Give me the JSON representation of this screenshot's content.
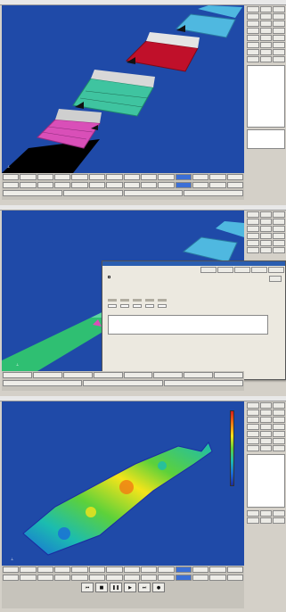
{
  "panel1": {
    "toolbar_rows": [
      [
        "",
        "",
        "",
        "",
        "",
        "",
        "",
        "",
        "",
        "",
        "",
        "",
        "",
        "",
        "",
        "",
        "",
        "",
        "",
        ""
      ],
      [
        "",
        "",
        "",
        "",
        "",
        "",
        "",
        "",
        "",
        "",
        "",
        "",
        "",
        "",
        "",
        "",
        "",
        "",
        "",
        ""
      ]
    ]
  },
  "panel2": {
    "dialog": {
      "title": "",
      "red_text": "",
      "checkbox_label": ""
    }
  },
  "panel3": {
    "legend_labels": [
      "",
      "",
      "",
      "",
      "",
      "",
      "",
      "",
      "",
      "",
      "",
      ""
    ]
  },
  "colors": {
    "viewport_bg": "#1f4aa8",
    "accent": "#3b6fd6",
    "map_high": "#d81b1b",
    "map_low": "#1b2ba0"
  },
  "icons": [
    "play-icon",
    "stop-icon",
    "pause-icon",
    "rewind-icon",
    "forward-icon",
    "record-icon"
  ]
}
